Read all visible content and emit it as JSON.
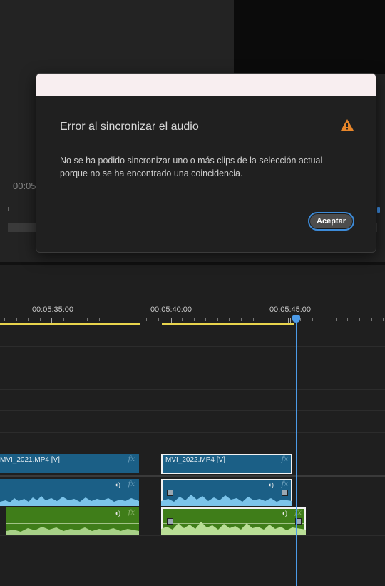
{
  "monitor": {
    "timecode": "00:05"
  },
  "timeline": {
    "ruler_labels": [
      "00:05:35:00",
      "00:05:40:00",
      "00:05:45:00"
    ],
    "clips": {
      "video_left": {
        "name": "MVI_2021.MP4 [V]",
        "fx": "fx"
      },
      "video_right": {
        "name": "MVI_2022.MP4 [V]",
        "fx": "fx"
      },
      "audio_fx": "fx"
    }
  },
  "dialog": {
    "title": "Error al sincronizar el audio",
    "message_line1": "No se ha podido sincronizar uno o más clips de la selección actual",
    "message_line2": "porque no se ha encontrado una coincidencia.",
    "accept_label": "Aceptar",
    "warning_color": "#e8862a",
    "accent_color": "#3d8bd8"
  }
}
